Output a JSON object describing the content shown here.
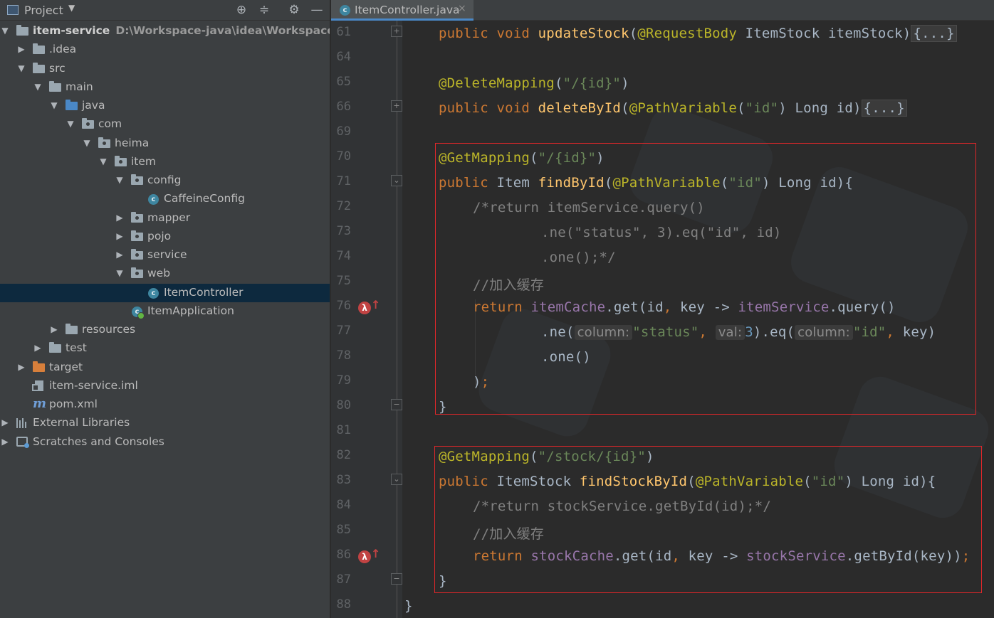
{
  "project_panel": {
    "title": "Project",
    "tree": [
      {
        "label": "item-service",
        "path": "D:\\Workspace-java\\idea\\Workspaces\\WS-HI",
        "level": 0,
        "expanded": true,
        "icon": "module-folder-icon",
        "bold": true
      },
      {
        "label": ".idea",
        "level": 1,
        "expanded": false,
        "icon": "folder-icon"
      },
      {
        "label": "src",
        "level": 1,
        "expanded": true,
        "icon": "folder-icon"
      },
      {
        "label": "main",
        "level": 2,
        "expanded": true,
        "icon": "folder-icon"
      },
      {
        "label": "java",
        "level": 3,
        "expanded": true,
        "icon": "source-folder-icon"
      },
      {
        "label": "com",
        "level": 4,
        "expanded": true,
        "icon": "package-icon"
      },
      {
        "label": "heima",
        "level": 5,
        "expanded": true,
        "icon": "package-icon"
      },
      {
        "label": "item",
        "level": 6,
        "expanded": true,
        "icon": "package-icon"
      },
      {
        "label": "config",
        "level": 7,
        "expanded": true,
        "icon": "package-icon"
      },
      {
        "label": "CaffeineConfig",
        "level": 8,
        "icon": "class-icon"
      },
      {
        "label": "mapper",
        "level": 7,
        "expanded": false,
        "icon": "package-icon"
      },
      {
        "label": "pojo",
        "level": 7,
        "expanded": false,
        "icon": "package-icon"
      },
      {
        "label": "service",
        "level": 7,
        "expanded": false,
        "icon": "package-icon"
      },
      {
        "label": "web",
        "level": 7,
        "expanded": true,
        "icon": "package-icon"
      },
      {
        "label": "ItemController",
        "level": 8,
        "icon": "class-icon",
        "selected": true
      },
      {
        "label": "ItemApplication",
        "level": 7,
        "icon": "spring-app-class-icon"
      },
      {
        "label": "resources",
        "level": 3,
        "expanded": false,
        "icon": "resources-folder-icon"
      },
      {
        "label": "test",
        "level": 2,
        "expanded": false,
        "icon": "folder-icon"
      },
      {
        "label": "target",
        "level": 1,
        "expanded": false,
        "icon": "excluded-folder-icon"
      },
      {
        "label": "item-service.iml",
        "level": 1,
        "icon": "iml-file-icon"
      },
      {
        "label": "pom.xml",
        "level": 1,
        "icon": "maven-icon"
      },
      {
        "label": "External Libraries",
        "level": 0,
        "expanded": false,
        "icon": "libraries-icon"
      },
      {
        "label": "Scratches and Consoles",
        "level": 0,
        "expanded": false,
        "icon": "scratches-icon"
      }
    ]
  },
  "editor": {
    "tab": {
      "label": "ItemController.java",
      "close": "×"
    },
    "line_numbers": [
      "61",
      "64",
      "65",
      "66",
      "69",
      "70",
      "71",
      "72",
      "73",
      "74",
      "75",
      "76",
      "77",
      "78",
      "79",
      "80",
      "81",
      "82",
      "83",
      "84",
      "85",
      "86",
      "87",
      "88"
    ],
    "fold_placeholder": "{...}",
    "code": {
      "l61": {
        "kw": "public void ",
        "fn": "updateStock",
        "p1": "(",
        "ann": "@RequestBody",
        "rest": " ItemStock itemStock)"
      },
      "l65": {
        "ann": "@DeleteMapping",
        "p1": "(",
        "str": "\"/{id}\"",
        "p2": ")"
      },
      "l66": {
        "kw": "public void ",
        "fn": "deleteById",
        "p1": "(",
        "ann": "@PathVariable",
        "p2": "(",
        "str": "\"id\"",
        "rest": ") Long id)"
      },
      "l70": {
        "ann": "@GetMapping",
        "p1": "(",
        "str": "\"/{id}\"",
        "p2": ")"
      },
      "l71": {
        "kw": "public ",
        "type": "Item ",
        "fn": "findById",
        "p1": "(",
        "ann": "@PathVariable",
        "p2": "(",
        "str": "\"id\"",
        "rest": ") Long id){"
      },
      "l72": {
        "cm": "/*return itemService.query()"
      },
      "l73": {
        "cm": ".ne(\"status\", 3).eq(\"id\", id)"
      },
      "l74": {
        "cm": ".one();*/"
      },
      "l75": {
        "cm": "//加入缓存"
      },
      "l76": {
        "kw": "return ",
        "fld": "itemCache",
        "t1": ".get(id",
        "kw2": ", ",
        "t2": "key -> ",
        "fld2": "itemService",
        "t3": ".query()"
      },
      "l77": {
        "t1": ".ne(",
        "hint1": "column:",
        "str1": "\"status\"",
        "kw1": ", ",
        "hint2": "val:",
        "num": "3",
        "t2": ").eq(",
        "hint3": "column:",
        "str2": "\"id\"",
        "kw2": ", ",
        "t3": "key)"
      },
      "l78": {
        "t1": ".one()"
      },
      "l79": {
        "t1": ")",
        "kw": ";"
      },
      "l80": {
        "t1": "}"
      },
      "l82": {
        "ann": "@GetMapping",
        "p1": "(",
        "str": "\"/stock/{id}\"",
        "p2": ")"
      },
      "l83": {
        "kw": "public ",
        "type": "ItemStock ",
        "fn": "findStockById",
        "p1": "(",
        "ann": "@PathVariable",
        "p2": "(",
        "str": "\"id\"",
        "rest": ") Long id){"
      },
      "l84": {
        "cm": "/*return stockService.getById(id);*/"
      },
      "l85": {
        "cm": "//加入缓存"
      },
      "l86": {
        "kw": "return ",
        "fld": "stockCache",
        "t1": ".get(id",
        "kw2": ", ",
        "t2": "key -> ",
        "fld2": "stockService",
        "t3": ".getById(key))",
        "kw3": ";"
      },
      "l87": {
        "t1": "}"
      },
      "l88": {
        "t1": "}"
      }
    }
  },
  "colors": {
    "keyword": "#cc7832",
    "annotation": "#bbb529",
    "method": "#ffc66d",
    "string": "#6a8759",
    "comment": "#808080",
    "field": "#9876aa",
    "number": "#6897bb",
    "highlight_box": "#e0272a"
  }
}
